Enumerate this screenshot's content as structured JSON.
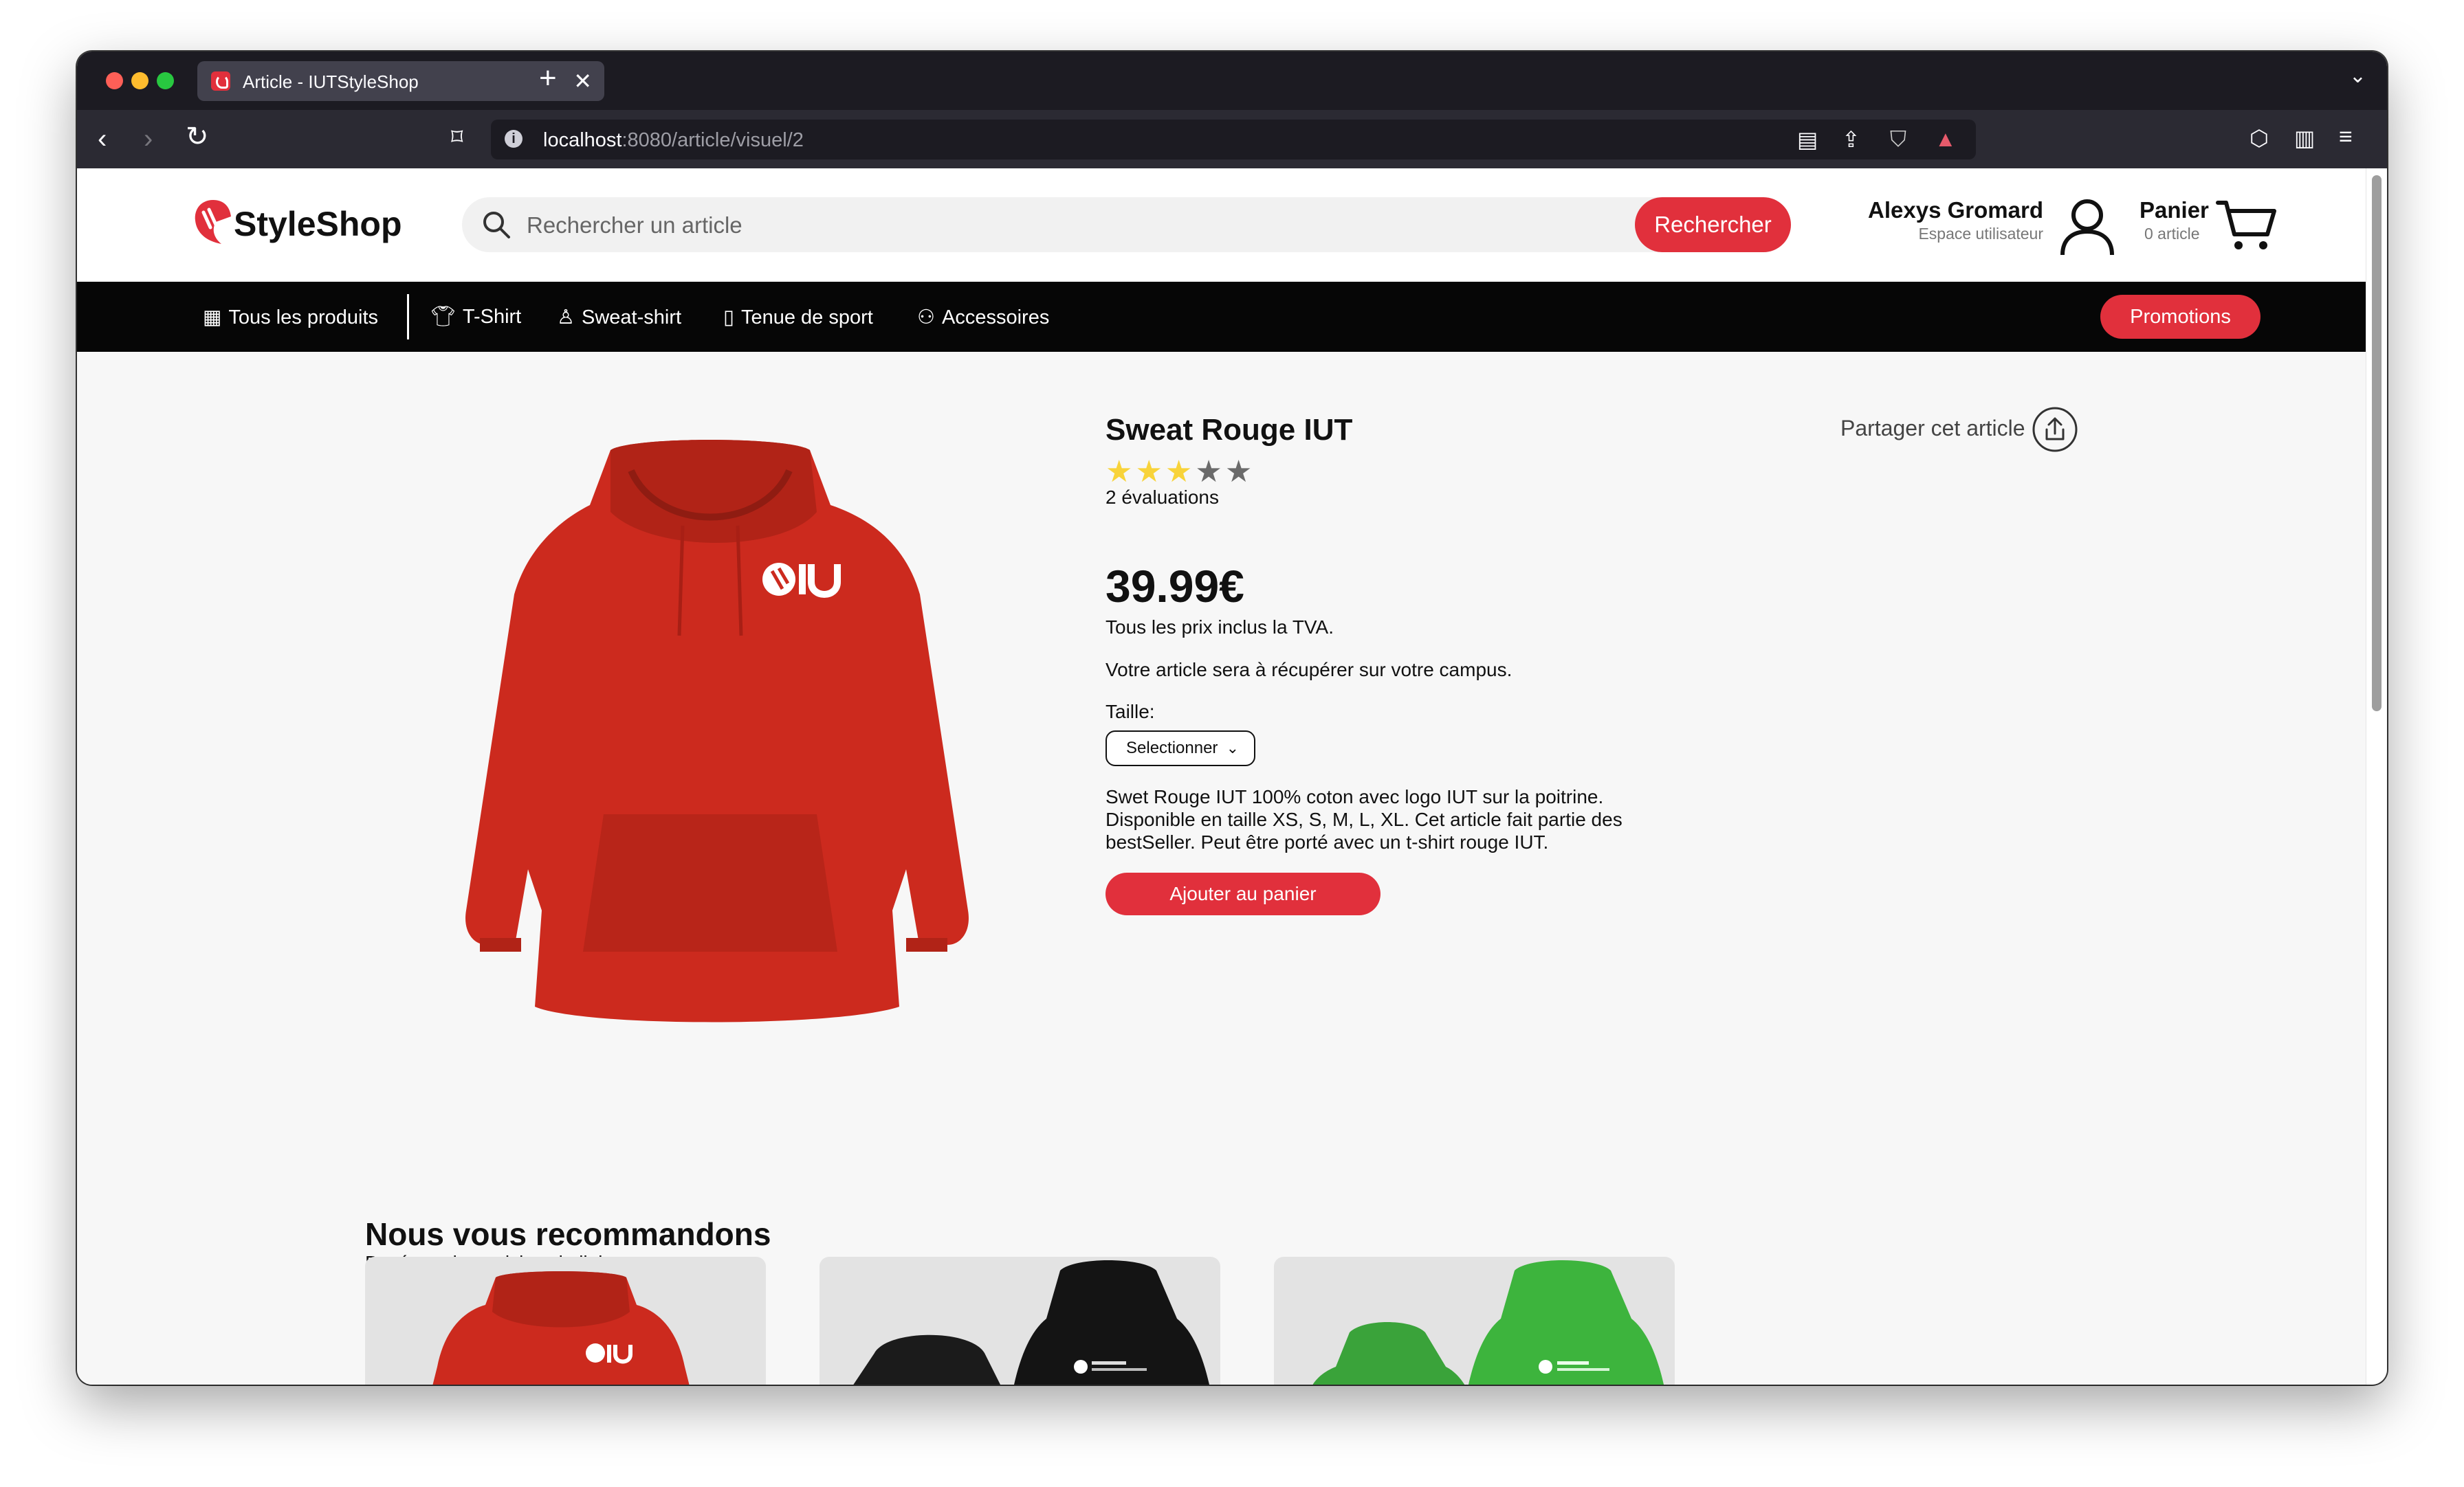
{
  "browser": {
    "tab_title": "Article - IUTStyleShop",
    "tab_close": "✕",
    "new_tab": "+",
    "url_host": "localhost",
    "url_path": ":8080/article/visuel/2"
  },
  "header": {
    "logo_text": "StyleShop",
    "search_placeholder": "Rechercher un article",
    "search_button": "Rechercher",
    "user_name": "Alexys Gromard",
    "user_subtitle": "Espace utilisateur",
    "cart_label": "Panier",
    "cart_count": "0 article"
  },
  "categories": [
    {
      "label": "Tous les produits",
      "icon": "grid-icon"
    },
    {
      "label": "T-Shirt",
      "icon": "tshirt-icon"
    },
    {
      "label": "Sweat-shirt",
      "icon": "sweatshirt-icon"
    },
    {
      "label": "Tenue de sport",
      "icon": "sport-icon"
    },
    {
      "label": "Accessoires",
      "icon": "glasses-icon"
    }
  ],
  "promotions": "Promotions",
  "product": {
    "title": "Sweat Rouge IUT",
    "rating": 3,
    "rating_max": 5,
    "reviews": "2 évaluations",
    "price": "39.99€",
    "tva": "Tous les prix inclus la TVA.",
    "pickup": "Votre article sera à récupérer sur votre campus.",
    "size_label": "Taille:",
    "size_value": "Selectionner",
    "description": "Swet Rouge IUT 100% coton avec logo IUT sur la poitrine. Disponible en taille XS, S, M, L, XL. Cet article fait partie des bestSeller. Peut être porté avec un t-shirt rouge IUT.",
    "add_to_cart": "Ajouter au panier",
    "share": "Partager cet article"
  },
  "recommendations": {
    "title": "Nous vous recommandons",
    "subtitle": "Basé sur des articles similaires"
  },
  "colors": {
    "accent": "#e1303c",
    "hoodie_red": "#cc2a1e",
    "hoodie_black": "#141414",
    "hoodie_green": "#3aa33a"
  }
}
